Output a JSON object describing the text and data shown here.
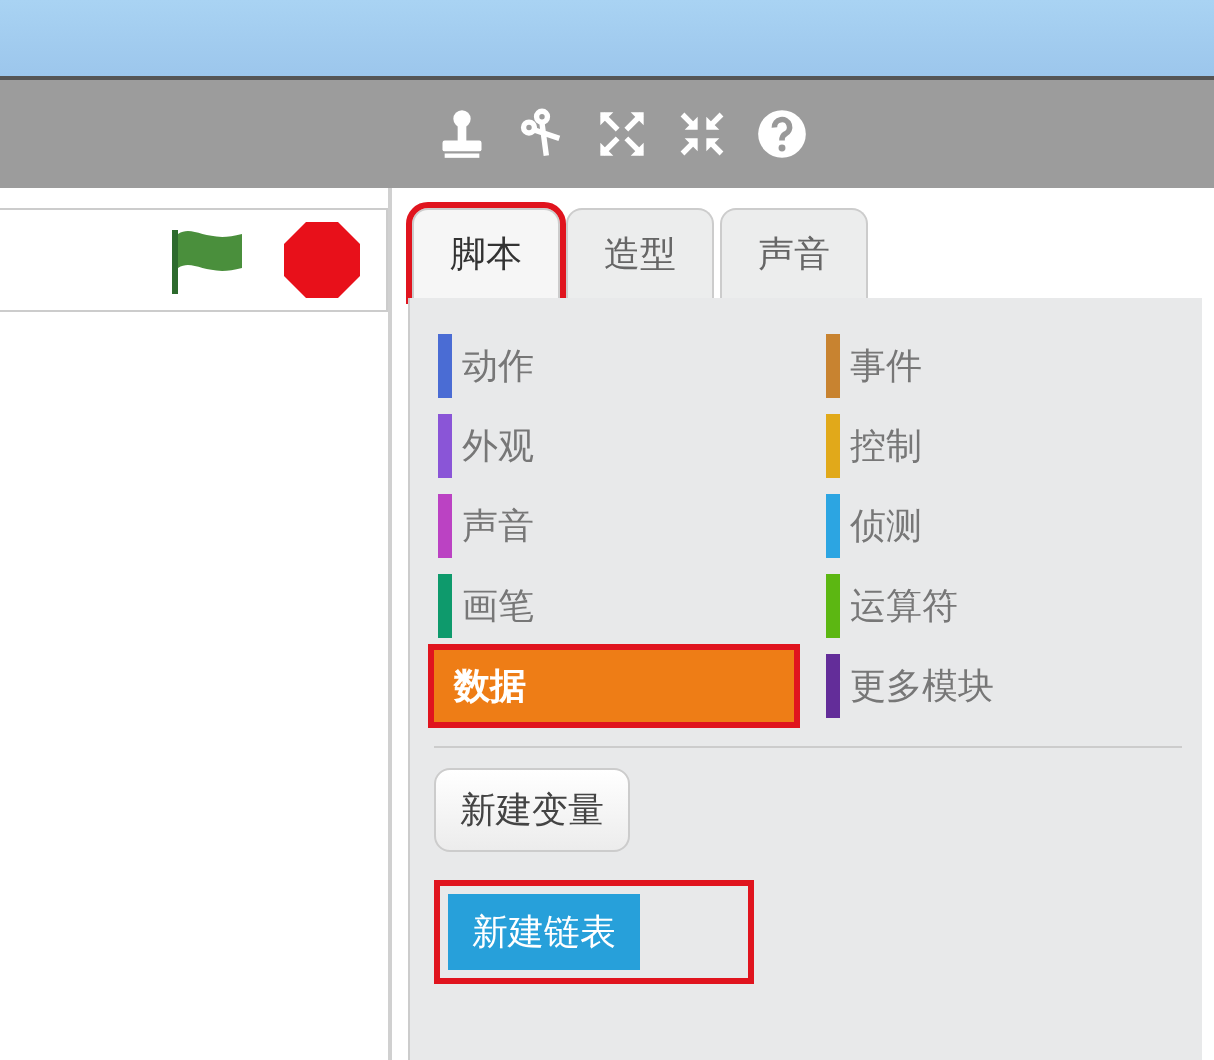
{
  "tabs": [
    {
      "label": "脚本",
      "selected": true,
      "highlighted": true
    },
    {
      "label": "造型",
      "selected": false,
      "highlighted": false
    },
    {
      "label": "声音",
      "selected": false,
      "highlighted": false
    }
  ],
  "categories": [
    {
      "label": "动作",
      "color": "#4a6cd4",
      "selected": false,
      "highlighted": false
    },
    {
      "label": "外观",
      "color": "#8a55d7",
      "selected": false,
      "highlighted": false
    },
    {
      "label": "声音",
      "color": "#bb42c3",
      "selected": false,
      "highlighted": false
    },
    {
      "label": "画笔",
      "color": "#0e9a6c",
      "selected": false,
      "highlighted": false
    },
    {
      "label": "数据",
      "color": "#ee7d16",
      "selected": true,
      "highlighted": true
    },
    {
      "label": "事件",
      "color": "#c88330",
      "selected": false,
      "highlighted": false
    },
    {
      "label": "控制",
      "color": "#e1a91a",
      "selected": false,
      "highlighted": false
    },
    {
      "label": "侦测",
      "color": "#2ca5e2",
      "selected": false,
      "highlighted": false
    },
    {
      "label": "运算符",
      "color": "#5cb712",
      "selected": false,
      "highlighted": false
    },
    {
      "label": "更多模块",
      "color": "#632d99",
      "selected": false,
      "highlighted": false
    }
  ],
  "buttons": [
    {
      "label": "新建变量",
      "hovered": false,
      "highlighted": false
    },
    {
      "label": "新建链表",
      "hovered": true,
      "highlighted": true
    }
  ]
}
